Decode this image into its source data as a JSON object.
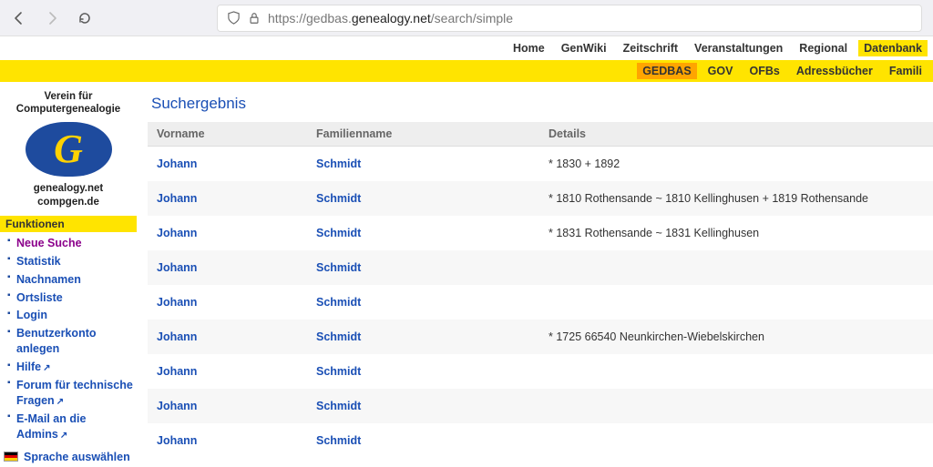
{
  "browser": {
    "url_pre": "https://gedbas.",
    "url_domain": "genealogy.net",
    "url_post": "/search/simple"
  },
  "topnav1": {
    "items": [
      "Home",
      "GenWiki",
      "Zeitschrift",
      "Veranstaltungen",
      "Regional",
      "Datenbank"
    ]
  },
  "topnav2": {
    "items": [
      "GEDBAS",
      "GOV",
      "OFBs",
      "Adressbücher",
      "Famili"
    ]
  },
  "logo": {
    "line1": "Verein für",
    "line2": "Computergenealogie",
    "glyph": "G",
    "sub1": "genealogy.net",
    "sub2": "compgen.de"
  },
  "funktionen": {
    "heading": "Funktionen",
    "items": [
      {
        "label": "Neue Suche",
        "sel": true
      },
      {
        "label": "Statistik"
      },
      {
        "label": "Nachnamen"
      },
      {
        "label": "Ortsliste"
      },
      {
        "label": "Login"
      },
      {
        "label": "Benutzerkonto anlegen"
      },
      {
        "label": "Hilfe",
        "ext": true
      },
      {
        "label": "Forum für technische Fragen",
        "ext": true
      },
      {
        "label": "E-Mail an die Admins",
        "ext": true
      }
    ],
    "lang": "Sprache auswählen"
  },
  "page": {
    "title": "Suchergebnis",
    "columns": [
      "Vorname",
      "Familienname",
      "Details"
    ],
    "rows": [
      {
        "vor": "Johann",
        "fam": "Schmidt",
        "det": "* 1830 + 1892"
      },
      {
        "vor": "Johann",
        "fam": "Schmidt",
        "det": "* 1810 Rothensande ~ 1810 Kellinghusen + 1819 Rothensande"
      },
      {
        "vor": "Johann",
        "fam": "Schmidt",
        "det": "* 1831 Rothensande ~ 1831 Kellinghusen"
      },
      {
        "vor": "Johann",
        "fam": "Schmidt",
        "det": ""
      },
      {
        "vor": "Johann",
        "fam": "Schmidt",
        "det": ""
      },
      {
        "vor": "Johann",
        "fam": "Schmidt",
        "det": "* 1725 66540 Neunkirchen-Wiebelskirchen"
      },
      {
        "vor": "Johann",
        "fam": "Schmidt",
        "det": ""
      },
      {
        "vor": "Johann",
        "fam": "Schmidt",
        "det": ""
      },
      {
        "vor": "Johann",
        "fam": "Schmidt",
        "det": ""
      }
    ]
  }
}
